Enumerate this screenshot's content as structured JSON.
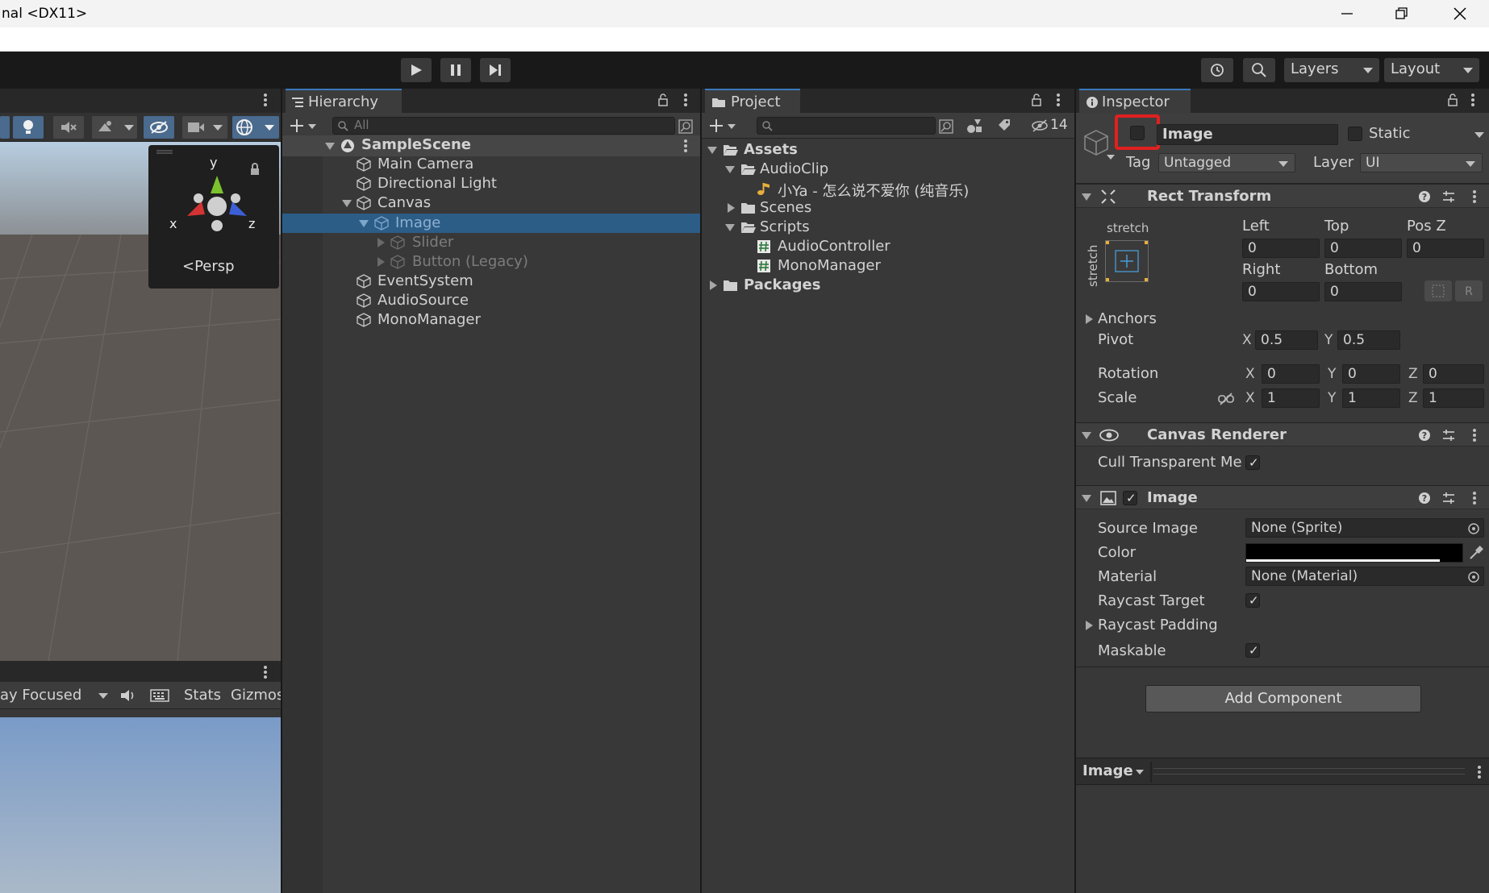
{
  "window": {
    "title": "nal <DX11>"
  },
  "toolbar": {
    "layers_label": "Layers",
    "layout_label": "Layout"
  },
  "scene_view": {
    "gizmo": {
      "axis_y": "y",
      "axis_x": "x",
      "axis_z": "z",
      "persp_label": "Persp"
    }
  },
  "game_view": {
    "focus_label": "ay Focused",
    "stats_label": "Stats",
    "gizmos_label": "Gizmos"
  },
  "hierarchy": {
    "tab_label": "Hierarchy",
    "search_placeholder": "All",
    "scene_name": "SampleScene",
    "items": [
      {
        "label": "Main Camera"
      },
      {
        "label": "Directional Light"
      },
      {
        "label": "Canvas"
      },
      {
        "label": "Image"
      },
      {
        "label": "Slider"
      },
      {
        "label": "Button (Legacy)"
      },
      {
        "label": "EventSystem"
      },
      {
        "label": "AudioSource"
      },
      {
        "label": "MonoManager"
      }
    ]
  },
  "project": {
    "tab_label": "Project",
    "hidden_count": "14",
    "items": [
      {
        "label": "Assets"
      },
      {
        "label": "AudioClip"
      },
      {
        "label": "小Ya - 怎么说不爱你 (纯音乐)"
      },
      {
        "label": "Scenes"
      },
      {
        "label": "Scripts"
      },
      {
        "label": "AudioController"
      },
      {
        "label": "MonoManager"
      },
      {
        "label": "Packages"
      }
    ]
  },
  "inspector": {
    "tab_label": "Inspector",
    "object_name": "Image",
    "static_label": "Static",
    "tag_label": "Tag",
    "tag_value": "Untagged",
    "layer_label": "Layer",
    "layer_value": "UI",
    "rect_transform": {
      "title": "Rect Transform",
      "anchor_h": "stretch",
      "anchor_v": "stretch",
      "left_label": "Left",
      "left": "0",
      "top_label": "Top",
      "top": "0",
      "posz_label": "Pos Z",
      "posz": "0",
      "right_label": "Right",
      "right": "0",
      "bottom_label": "Bottom",
      "bottom": "0",
      "anchors_label": "Anchors",
      "pivot_label": "Pivot",
      "pivot_x": "0.5",
      "pivot_y": "0.5",
      "rotation_label": "Rotation",
      "rot_x": "0",
      "rot_y": "0",
      "rot_z": "0",
      "scale_label": "Scale",
      "scale_x": "1",
      "scale_y": "1",
      "scale_z": "1",
      "x": "X",
      "y": "Y",
      "z": "Z"
    },
    "canvas_renderer": {
      "title": "Canvas Renderer",
      "cull_label": "Cull Transparent Me"
    },
    "image_component": {
      "title": "Image",
      "source_label": "Source Image",
      "source_value": "None (Sprite)",
      "color_label": "Color",
      "color_value": "#000000",
      "material_label": "Material",
      "material_value": "None (Material)",
      "raycast_target_label": "Raycast Target",
      "raycast_padding_label": "Raycast Padding",
      "maskable_label": "Maskable"
    },
    "add_component_label": "Add Component",
    "preview_label": "Image"
  },
  "colors": {
    "accent": "#3a79bb",
    "highlight_box": "#e02020",
    "selection": "#2c5d87"
  }
}
